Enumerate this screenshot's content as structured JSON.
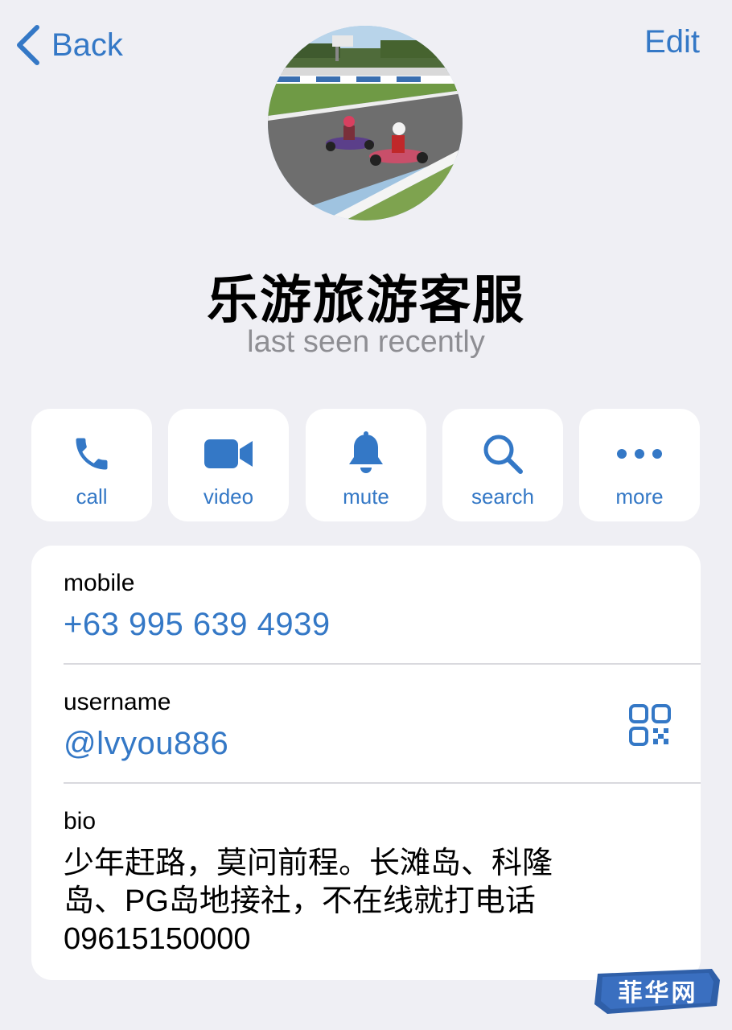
{
  "nav": {
    "back_label": "Back",
    "edit_label": "Edit"
  },
  "profile": {
    "name": "乐游旅游客服",
    "status": "last seen recently"
  },
  "actions": [
    {
      "label": "call",
      "icon": "phone-icon"
    },
    {
      "label": "video",
      "icon": "video-camera-icon"
    },
    {
      "label": "mute",
      "icon": "bell-icon"
    },
    {
      "label": "search",
      "icon": "search-icon"
    },
    {
      "label": "more",
      "icon": "more-dots-icon"
    }
  ],
  "info": {
    "mobile_label": "mobile",
    "mobile_value": "+63 995 639 4939",
    "username_label": "username",
    "username_value": "@lvyou886",
    "bio_label": "bio",
    "bio_value": "少年赶路，莫问前程。长滩岛、科隆\n岛、PG岛地接社，不在线就打电话\n09615150000"
  },
  "watermark": {
    "text": "菲华网"
  },
  "colors": {
    "background": "#efeff4",
    "accent": "#3478c6",
    "secondary_text": "#8e8e93",
    "card": "#ffffff"
  }
}
